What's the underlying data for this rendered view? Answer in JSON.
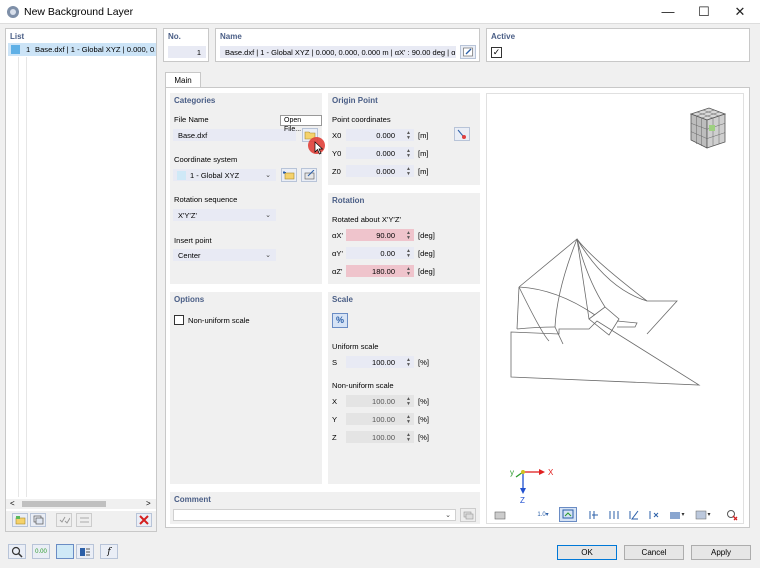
{
  "window": {
    "title": "New Background Layer",
    "minimize": "—",
    "maximize": "☐",
    "close": "✕"
  },
  "list": {
    "header": "List",
    "item_num": "1",
    "item_text": "Base.dxf | 1 - Global XYZ | 0.000, 0.0",
    "scroll_left": "<",
    "scroll_right": ">"
  },
  "no": {
    "header": "No.",
    "value": "1"
  },
  "name": {
    "header": "Name",
    "value": "Base.dxf | 1 - Global XYZ | 0.000, 0.000, 0.000 m | αX' : 90.00 deg | α"
  },
  "active": {
    "header": "Active",
    "checked": "✓"
  },
  "tabs": {
    "main": "Main"
  },
  "categories": {
    "header": "Categories",
    "file_name_label": "File Name",
    "file_name_value": "Base.dxf",
    "open_file_tooltip": "Open File...",
    "coord_label": "Coordinate system",
    "coord_value": "1 - Global XYZ",
    "rot_seq_label": "Rotation sequence",
    "rot_seq_value": "X'Y'Z'",
    "insert_label": "Insert point",
    "insert_value": "Center"
  },
  "origin": {
    "header": "Origin Point",
    "coords_label": "Point coordinates",
    "rows": [
      {
        "label": "X0",
        "value": "0.000",
        "unit": "[m]"
      },
      {
        "label": "Y0",
        "value": "0.000",
        "unit": "[m]"
      },
      {
        "label": "Z0",
        "value": "0.000",
        "unit": "[m]"
      }
    ]
  },
  "rotation": {
    "header": "Rotation",
    "about_label": "Rotated about X'Y'Z'",
    "rows": [
      {
        "label": "αX'",
        "value": "90.00",
        "unit": "[deg]"
      },
      {
        "label": "αY'",
        "value": "0.00",
        "unit": "[deg]"
      },
      {
        "label": "αZ'",
        "value": "180.00",
        "unit": "[deg]"
      }
    ]
  },
  "options": {
    "header": "Options",
    "non_uniform_label": "Non-uniform scale"
  },
  "scale": {
    "header": "Scale",
    "percent_icon": "%",
    "uniform_label": "Uniform scale",
    "s_label": "S",
    "s_value": "100.00",
    "s_unit": "[%]",
    "non_uniform_label": "Non-uniform scale",
    "rows": [
      {
        "label": "X",
        "value": "100.00",
        "unit": "[%]"
      },
      {
        "label": "Y",
        "value": "100.00",
        "unit": "[%]"
      },
      {
        "label": "Z",
        "value": "100.00",
        "unit": "[%]"
      }
    ]
  },
  "comment": {
    "header": "Comment"
  },
  "axes": {
    "x": "X",
    "y": "y",
    "z": "Z"
  },
  "viewer_toolbar": {
    "scale_label": "1.0"
  },
  "bottom": {
    "ok": "OK",
    "cancel": "Cancel",
    "apply": "Apply",
    "num_icon": "0.00"
  },
  "colors": {
    "header_text": "#4a5e86",
    "accent_blue": "#2b5fa8",
    "red_field": "#efc4cc",
    "selection": "#cce4f7"
  }
}
